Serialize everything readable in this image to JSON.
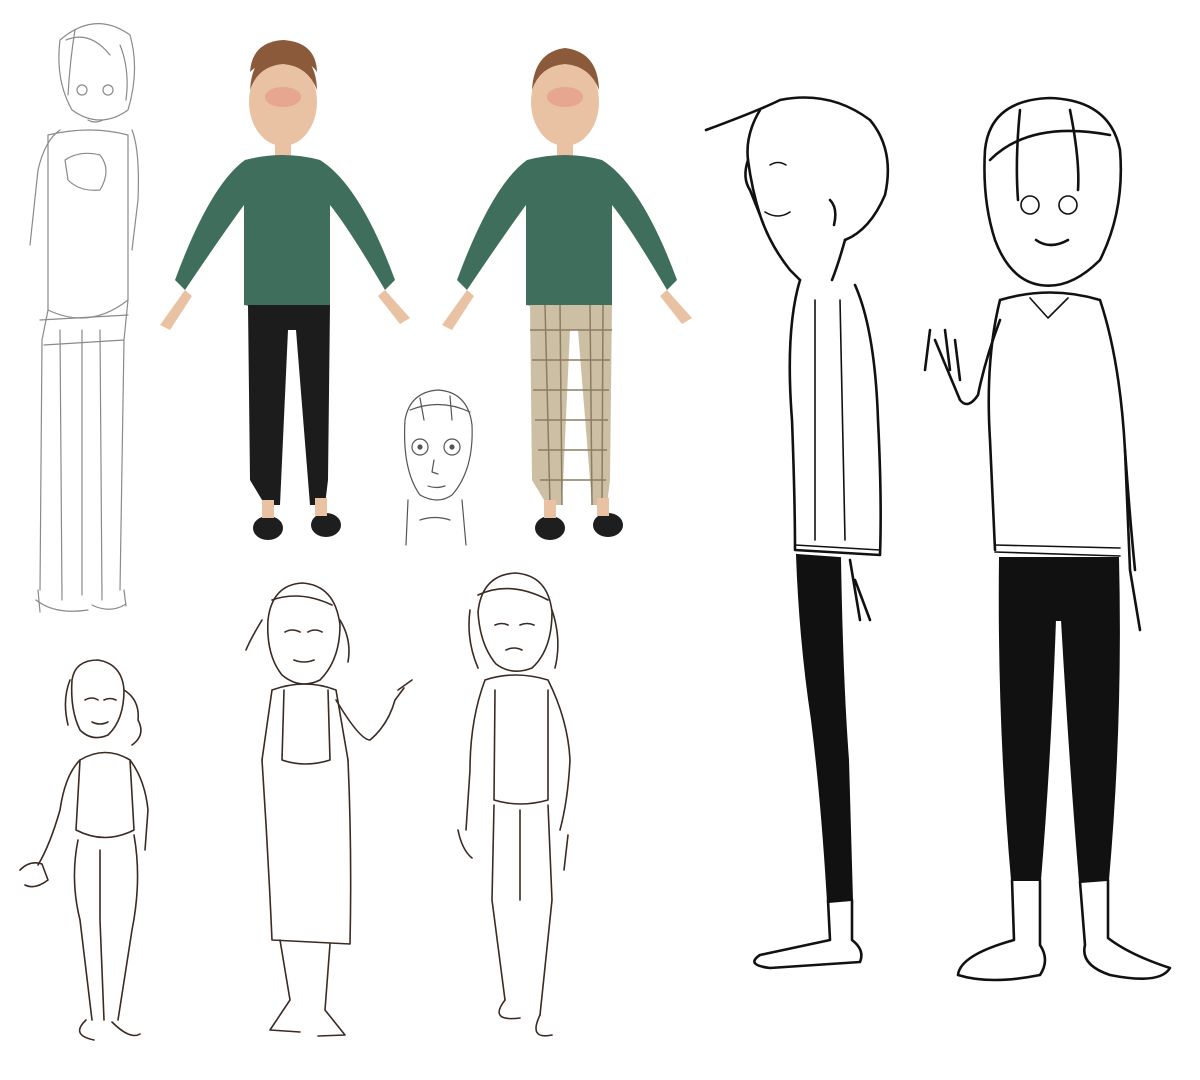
{
  "canvas": {
    "background": "#ffffff"
  },
  "palette": {
    "skin": "#e8c2a3",
    "hair": "#8a5a3a",
    "blush": "#e79a86",
    "sweater": "#3f6f5c",
    "pants_dark": "#1c1c1c",
    "pants_plaid": "#cdbfa4",
    "plaid_lines": "#8b7d62",
    "shoes": "#1e1e1e",
    "pencil_line": "#8a8a8a",
    "brown_line": "#3a2a22",
    "ink_line": "#111111"
  },
  "figures": [
    {
      "id": "pencil-sketch-standing",
      "style": "pencil"
    },
    {
      "id": "color-turnaround-dark-pants",
      "style": "color"
    },
    {
      "id": "color-turnaround-plaid-pants",
      "style": "color"
    },
    {
      "id": "face-study",
      "style": "pencil"
    },
    {
      "id": "sketch-open-hand",
      "style": "brown"
    },
    {
      "id": "sketch-apron-pointing",
      "style": "brown"
    },
    {
      "id": "sketch-sad-standing",
      "style": "brown"
    },
    {
      "id": "ink-profile-view",
      "style": "ink"
    },
    {
      "id": "ink-front-waving",
      "style": "ink"
    }
  ]
}
